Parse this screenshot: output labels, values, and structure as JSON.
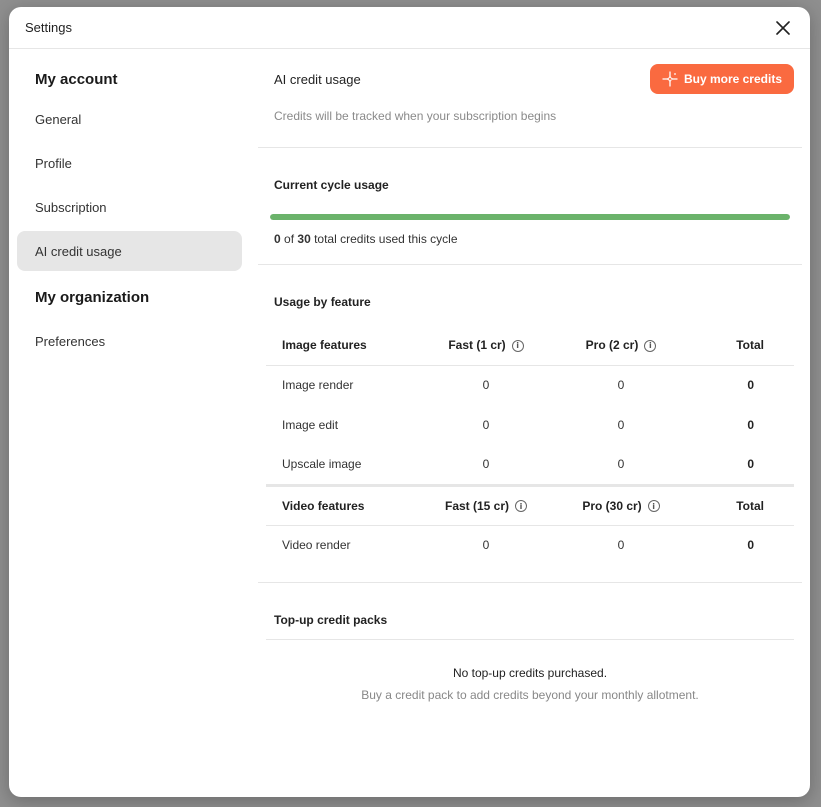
{
  "modal": {
    "title": "Settings"
  },
  "sidebar": {
    "sections": [
      {
        "label": "My account",
        "items": [
          {
            "label": "General",
            "active": false
          },
          {
            "label": "Profile",
            "active": false
          },
          {
            "label": "Subscription",
            "active": false
          },
          {
            "label": "AI credit usage",
            "active": true
          }
        ]
      },
      {
        "label": "My organization",
        "items": [
          {
            "label": "Preferences",
            "active": false
          }
        ]
      }
    ]
  },
  "credit_usage": {
    "title": "AI credit usage",
    "buy_button": "Buy more credits",
    "note": "Credits will be tracked when your subscription begins"
  },
  "current_cycle": {
    "title": "Current cycle usage",
    "used": "0",
    "of_label": "of",
    "total": "30",
    "suffix": "total credits used this cycle",
    "progress_fraction": 1.0,
    "progress_color": "#6bb36b"
  },
  "usage_by_feature": {
    "title": "Usage by feature",
    "image": {
      "headers": [
        "Image features",
        "Fast (1 cr)",
        "Pro (2 cr)",
        "Total"
      ],
      "rows": [
        [
          "Image render",
          "0",
          "0",
          "0"
        ],
        [
          "Image edit",
          "0",
          "0",
          "0"
        ],
        [
          "Upscale image",
          "0",
          "0",
          "0"
        ]
      ]
    },
    "video": {
      "headers": [
        "Video features",
        "Fast (15 cr)",
        "Pro (30 cr)",
        "Total"
      ],
      "rows": [
        [
          "Video render",
          "0",
          "0",
          "0"
        ]
      ]
    }
  },
  "topup": {
    "title": "Top-up credit packs",
    "empty_title": "No top-up credits purchased.",
    "empty_desc": "Buy a credit pack to add credits beyond your monthly allotment."
  },
  "colors": {
    "accent": "#fa6a40",
    "active_bg": "#e6e6e6"
  },
  "icons": {
    "close": "close-icon",
    "sparkle": "sparkle-icon",
    "info": "info-icon"
  }
}
